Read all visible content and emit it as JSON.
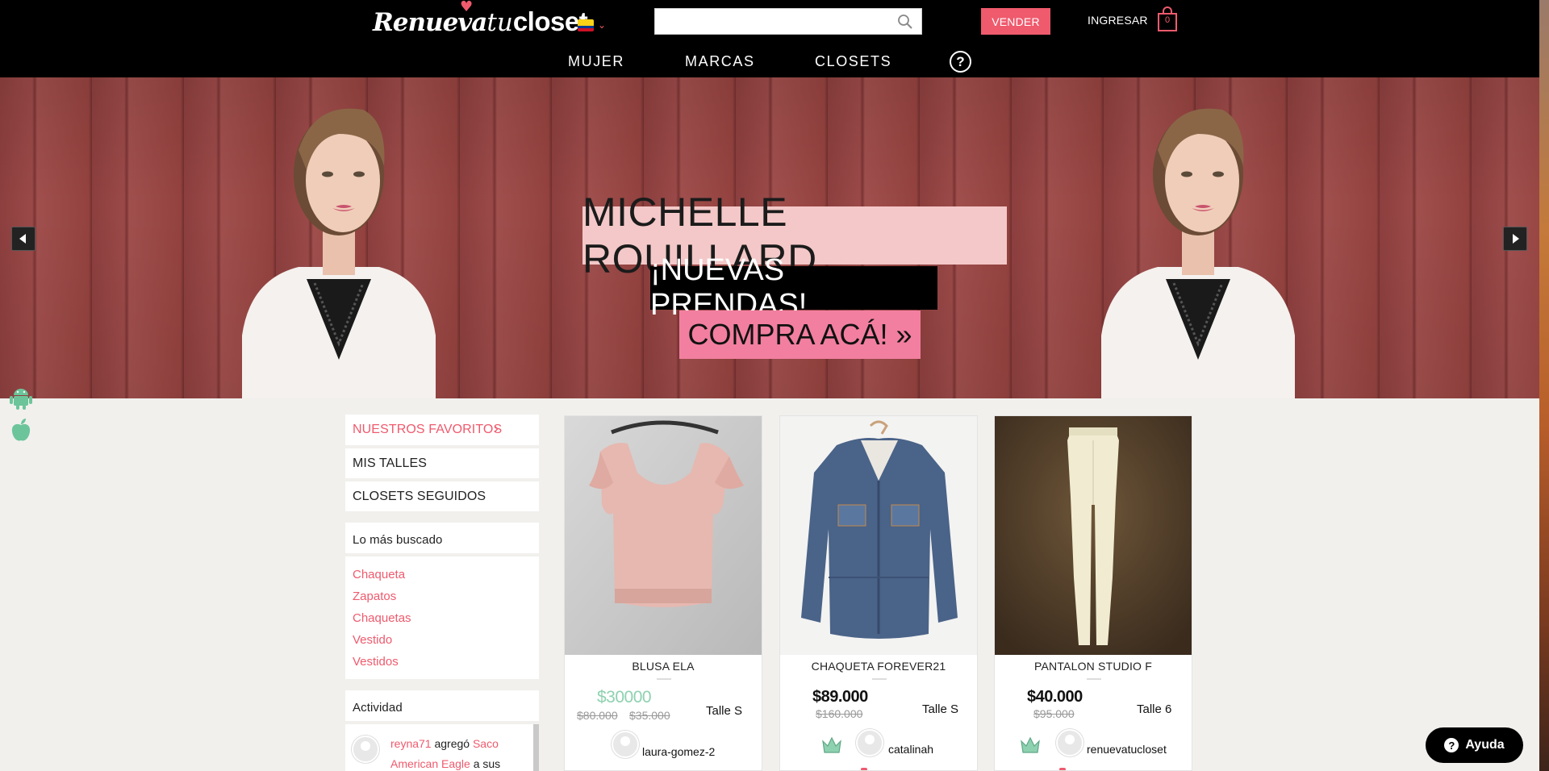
{
  "header": {
    "logo": {
      "part1": "Renueva",
      "part2": "tu",
      "part3": "closet"
    },
    "flag_colors": [
      "#fcd116",
      "#003893",
      "#ce1126"
    ],
    "search": {
      "value": "",
      "placeholder": ""
    },
    "sell_button": "VENDER",
    "login_link": "INGRESAR",
    "cart_count": "0",
    "nav": [
      "MUJER",
      "MARCAS",
      "CLOSETS"
    ],
    "help_icon": "?"
  },
  "hero": {
    "line1": "MICHELLE ROUILLARD",
    "line2": "¡NUEVAS PRENDAS!",
    "line3": "COMPRA ACÁ! »"
  },
  "sidebar": {
    "favorites": "NUESTROS FAVORITOS",
    "favorites_arrow": "›",
    "my_sizes": "MIS TALLES",
    "followed": "CLOSETS SEGUIDOS",
    "most_searched_title": "Lo más buscado",
    "most_searched": [
      "Chaqueta",
      "Zapatos",
      "Chaquetas",
      "Vestido",
      "Vestidos"
    ],
    "activity_title": "Actividad",
    "activity": {
      "user": "reyna71",
      "verb": "agregó",
      "item_1": "Saco",
      "item_2": "American Eagle",
      "tail": "a sus"
    }
  },
  "products": [
    {
      "title": "BLUSA ELA",
      "price": "$30000",
      "original_1": "$80.000",
      "original_2": "$35.000",
      "size": "Talle S",
      "seller": "laura-gomez-2"
    },
    {
      "title": "CHAQUETA FOREVER21",
      "price": "$89.000",
      "original_1": "$160.000",
      "size": "Talle S",
      "seller": "catalinah"
    },
    {
      "title": "PANTALON STUDIO F",
      "price": "$40.000",
      "original_1": "$95.000",
      "size": "Talle 6",
      "seller": "renuevatucloset"
    }
  ],
  "help_button": {
    "icon": "?",
    "label": "Ayuda"
  },
  "colors": {
    "accent": "#ef5a6d",
    "sale": "#8ed1b0",
    "header": "#000000",
    "page_bg": "#f1f0ed"
  },
  "icons": [
    "search-icon",
    "shopping-bag-icon",
    "help-circle-icon",
    "android-icon",
    "apple-icon",
    "crown-icon",
    "chevron-left-icon",
    "chevron-right-icon"
  ]
}
